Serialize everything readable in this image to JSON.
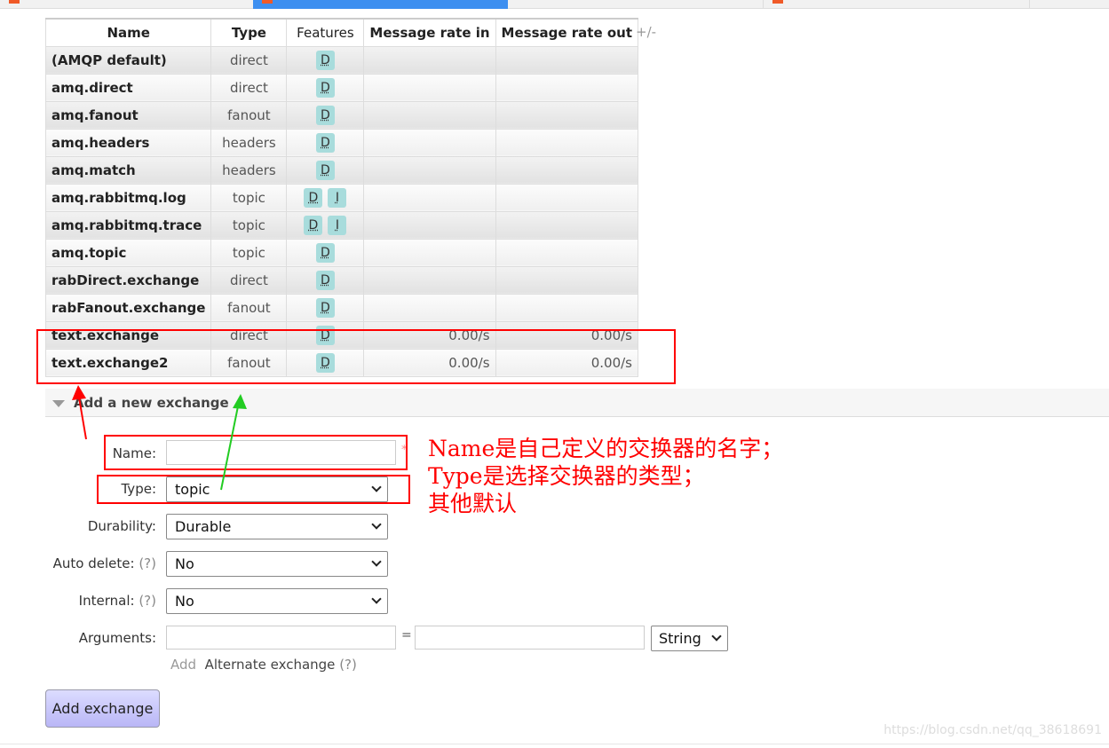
{
  "table": {
    "headers": [
      "Name",
      "Type",
      "Features",
      "Message rate in",
      "Message rate out"
    ],
    "plus_minus": "+/-",
    "rows": [
      {
        "name": "(AMQP default)",
        "type": "direct",
        "features": [
          "D"
        ],
        "in": "",
        "out": ""
      },
      {
        "name": "amq.direct",
        "type": "direct",
        "features": [
          "D"
        ],
        "in": "",
        "out": ""
      },
      {
        "name": "amq.fanout",
        "type": "fanout",
        "features": [
          "D"
        ],
        "in": "",
        "out": ""
      },
      {
        "name": "amq.headers",
        "type": "headers",
        "features": [
          "D"
        ],
        "in": "",
        "out": ""
      },
      {
        "name": "amq.match",
        "type": "headers",
        "features": [
          "D"
        ],
        "in": "",
        "out": ""
      },
      {
        "name": "amq.rabbitmq.log",
        "type": "topic",
        "features": [
          "D",
          "I"
        ],
        "in": "",
        "out": ""
      },
      {
        "name": "amq.rabbitmq.trace",
        "type": "topic",
        "features": [
          "D",
          "I"
        ],
        "in": "",
        "out": ""
      },
      {
        "name": "amq.topic",
        "type": "topic",
        "features": [
          "D"
        ],
        "in": "",
        "out": ""
      },
      {
        "name": "rabDirect.exchange",
        "type": "direct",
        "features": [
          "D"
        ],
        "in": "",
        "out": ""
      },
      {
        "name": "rabFanout.exchange",
        "type": "fanout",
        "features": [
          "D"
        ],
        "in": "",
        "out": ""
      },
      {
        "name": "text.exchange",
        "type": "direct",
        "features": [
          "D"
        ],
        "in": "0.00/s",
        "out": "0.00/s"
      },
      {
        "name": "text.exchange2",
        "type": "fanout",
        "features": [
          "D"
        ],
        "in": "0.00/s",
        "out": "0.00/s"
      }
    ]
  },
  "form": {
    "section_title": "Add a new exchange",
    "name_label": "Name:",
    "name_value": "",
    "required_mark": "*",
    "type_label": "Type:",
    "type_value": "topic",
    "durability_label": "Durability:",
    "durability_value": "Durable",
    "auto_delete_label": "Auto delete:",
    "auto_delete_value": "No",
    "internal_label": "Internal:",
    "internal_value": "No",
    "help": "(?)",
    "arguments_label": "Arguments:",
    "equals": "=",
    "arg_type_value": "String",
    "add_label": "Add",
    "alternate_exchange": "Alternate exchange",
    "submit": "Add exchange"
  },
  "annotation": {
    "lines": [
      "Name是自己定义的交换器的名字；",
      "Type是选择交换器的类型；",
      "其他默认"
    ],
    "color": "#ff0000"
  },
  "watermark": "https://blog.csdn.net/qq_38618691"
}
